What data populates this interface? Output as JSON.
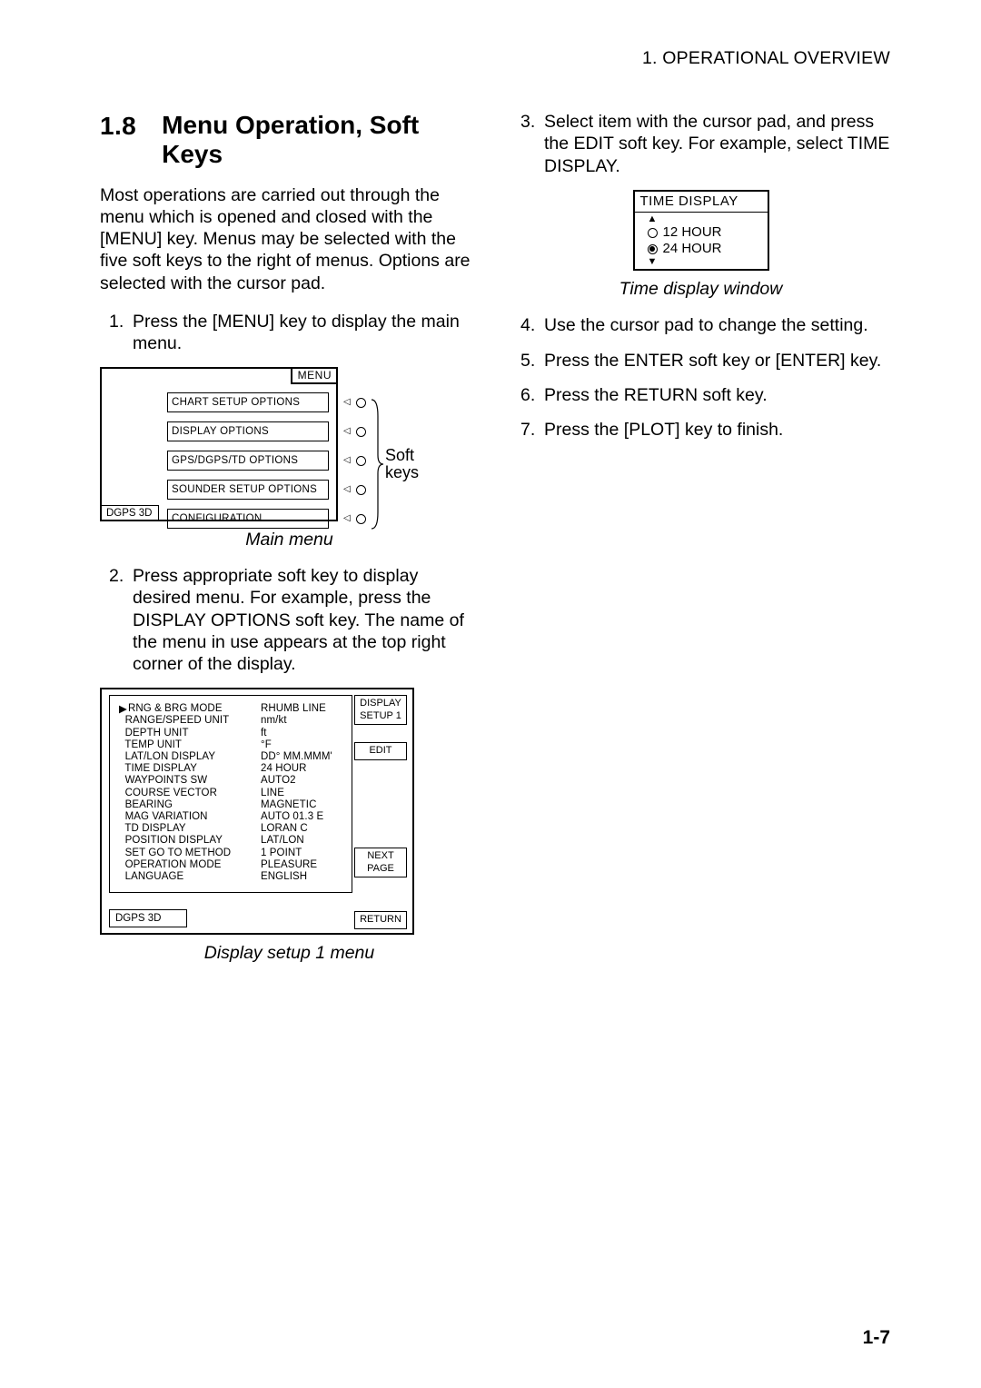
{
  "running_head": "1. OPERATIONAL OVERVIEW",
  "section": {
    "number": "1.8",
    "title": "Menu Operation, Soft Keys"
  },
  "intro": "Most operations are carried out through the menu which is opened and closed with the [MENU] key. Menus may be selected with the five soft keys to the right of menus. Options are selected with the cursor pad.",
  "left_steps": {
    "s1": "Press the [MENU] key to display the main menu.",
    "s2": "Press appropriate soft key to display desired menu. For example, press the DISPLAY OPTIONS soft key. The name of the menu in use appears at the top right corner of the display."
  },
  "right_steps": {
    "s3": "Select item with the cursor pad, and press the EDIT soft key. For example, select TIME DISPLAY.",
    "s4": "Use the cursor pad to change the setting.",
    "s5": "Press the ENTER soft key or [ENTER] key.",
    "s6": "Press the RETURN soft key.",
    "s7": "Press the [PLOT] key to finish."
  },
  "main_menu": {
    "label": "MENU",
    "items": [
      "CHART SETUP OPTIONS",
      "DISPLAY OPTIONS",
      "GPS/DGPS/TD OPTIONS",
      "SOUNDER SETUP OPTIONS",
      "CONFIGURATION"
    ],
    "status": "DGPS 3D",
    "side_label": "Soft\nkeys",
    "caption": "Main menu"
  },
  "display_setup": {
    "softkeys": {
      "title": "DISPLAY\nSETUP 1",
      "edit": "EDIT",
      "next": "NEXT\nPAGE",
      "ret": "RETURN"
    },
    "status": "DGPS 3D",
    "rows": [
      {
        "k": "RNG & BRG MODE",
        "v": "RHUMB LINE",
        "cursor": true
      },
      {
        "k": "RANGE/SPEED UNIT",
        "v": "nm/kt"
      },
      {
        "k": "DEPTH UNIT",
        "v": "ft"
      },
      {
        "k": "TEMP UNIT",
        "v": "°F"
      },
      {
        "k": "LAT/LON DISPLAY",
        "v": "DD° MM.MMM'"
      },
      {
        "k": "TIME DISPLAY",
        "v": "24 HOUR"
      },
      {
        "k": "WAYPOINTS SW",
        "v": "AUTO2"
      },
      {
        "k": "COURSE VECTOR",
        "v": "LINE"
      },
      {
        "k": "BEARING",
        "v": "MAGNETIC"
      },
      {
        "k": "MAG VARIATION",
        "v": "AUTO 01.3 E"
      },
      {
        "k": "TD DISPLAY",
        "v": "LORAN C"
      },
      {
        "k": "POSITION DISPLAY",
        "v": "LAT/LON"
      },
      {
        "k": "SET GO TO METHOD",
        "v": "1 POINT"
      },
      {
        "k": "OPERATION MODE",
        "v": "PLEASURE"
      },
      {
        "k": "LANGUAGE",
        "v": "ENGLISH"
      }
    ],
    "caption": "Display setup 1 menu"
  },
  "time_display": {
    "title": "TIME DISPLAY",
    "opt1": "12 HOUR",
    "opt2": "24 HOUR",
    "caption": "Time display window"
  },
  "page_number": "1-7"
}
